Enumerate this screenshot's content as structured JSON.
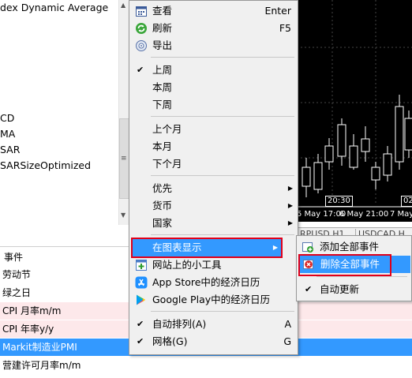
{
  "navigator": {
    "items": [
      "dex Dynamic Average",
      "CD",
      "MA",
      "SAR",
      "SARSizeOptimized"
    ]
  },
  "chart": {
    "time_labels": [
      "5 May 17:00",
      "6 May 21:00",
      "7 May"
    ],
    "box_labels": [
      "20:30",
      "02"
    ],
    "tabs": [
      "RPUSD,H1",
      "USDCAD,H"
    ]
  },
  "calendar": {
    "header": "事件",
    "rows": [
      {
        "text": "劳动节",
        "style": "white"
      },
      {
        "text": "绿之日",
        "style": "white"
      },
      {
        "text": "CPI 月率m/m",
        "style": "pink"
      },
      {
        "text": "CPI 年率y/y",
        "style": "pink"
      },
      {
        "text": "Markit制造业PMI",
        "style": "blue"
      },
      {
        "text": "营建许可月率m/m",
        "style": "white"
      }
    ]
  },
  "context_menu": {
    "view": {
      "label": "查看",
      "shortcut": "Enter",
      "icon": "calendar-icon"
    },
    "refresh": {
      "label": "刷新",
      "shortcut": "F5",
      "icon": "refresh-icon"
    },
    "export": {
      "label": "导出",
      "icon": "export-icon"
    },
    "last_week": "上周",
    "this_week": "本周",
    "next_week": "下周",
    "last_month": "上个月",
    "this_month": "本月",
    "next_month": "下个月",
    "priority": "优先",
    "currency": "货币",
    "country": "国家",
    "show_on_chart": "在图表显示",
    "web_widget": {
      "label": "网站上的小工具",
      "icon": "widget-icon"
    },
    "app_store": {
      "label": "App Store中的经济日历",
      "icon": "app-store-icon"
    },
    "google_play": {
      "label": "Google Play中的经济日历",
      "icon": "google-play-icon"
    },
    "auto_arrange": {
      "label": "自动排列(A)",
      "shortcut": "A"
    },
    "grid": {
      "label": "网格(G)",
      "shortcut": "G"
    }
  },
  "submenu": {
    "add_all_events": {
      "label": "添加全部事件",
      "icon": "add-events-icon"
    },
    "remove_all_events": {
      "label": "删除全部事件",
      "icon": "remove-events-icon"
    },
    "auto_update": "自动更新"
  },
  "colors": {
    "menu_bg": "#f0f0f0",
    "highlight": "#3399ff",
    "annotation_red": "#e0001a",
    "row_pink": "#fde8ea",
    "chart_bg": "#000000",
    "candle_up": "#ffffff",
    "candle_down": "#ffffff"
  }
}
